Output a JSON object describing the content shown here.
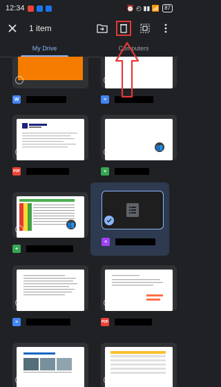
{
  "status": {
    "time": "12:34",
    "right_text": "⏰ ◴ ▮▮ 📶",
    "battery": "87"
  },
  "toolbar": {
    "title": "1 item"
  },
  "tabs": [
    {
      "label": "My Drive"
    },
    {
      "label": "Computers"
    }
  ],
  "colors": {
    "background": "#202124",
    "accent": "#8ab4f8",
    "annotation": "#e53935"
  },
  "files": [
    {
      "type_icon": "W",
      "icon_color": "#4285f4"
    },
    {
      "type_icon": "≡",
      "icon_color": "#4285f4"
    },
    {
      "type_icon": "PDF",
      "icon_color": "#ea4335"
    },
    {
      "type_icon": "+",
      "icon_color": "#34a853"
    },
    {
      "type_icon": "+",
      "icon_color": "#34a853"
    },
    {
      "type_icon": "≡",
      "icon_color": "#a142f4"
    },
    {
      "type_icon": "≡",
      "icon_color": "#4285f4"
    },
    {
      "type_icon": "PDF",
      "icon_color": "#ea4335"
    }
  ]
}
